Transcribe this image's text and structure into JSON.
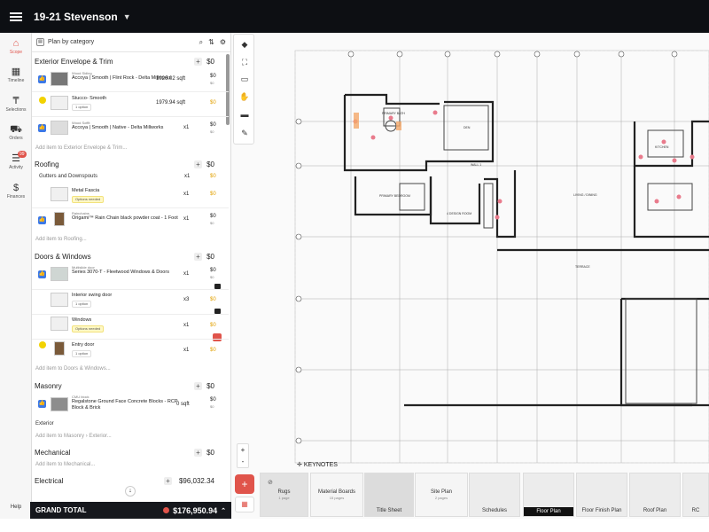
{
  "topbar": {
    "project_name": "19-21 Stevenson"
  },
  "nav": {
    "items": [
      {
        "label": "Scope",
        "icon": "home-icon"
      },
      {
        "label": "Timeline",
        "icon": "calendar-icon"
      },
      {
        "label": "Selections",
        "icon": "paint-roller-icon"
      },
      {
        "label": "Orders",
        "icon": "cart-icon"
      },
      {
        "label": "Activity",
        "icon": "activity-icon",
        "badge": "99"
      },
      {
        "label": "Finances",
        "icon": "dollar-icon"
      }
    ],
    "help": "Help"
  },
  "panel": {
    "header": "Plan by category",
    "sections": {
      "exterior": {
        "title": "Exterior Envelope & Trim",
        "total": "$0",
        "items": [
          {
            "category": "Wood Siding",
            "name": "Accoya | Smooth | Flint Rock - Delta Millworks",
            "qty": "1026.02 sqft",
            "price": "$0",
            "sub": "$0"
          },
          {
            "name": "Stucco- Smooth",
            "tag": "1 option",
            "qty": "1979.94 sqft",
            "price": "$0"
          },
          {
            "category": "Wood Soffit",
            "name": "Accoya | Smooth | Native - Delta Millworks",
            "qty": "x1",
            "price": "$0",
            "sub": "$0"
          }
        ],
        "add": "Add item to Exterior Envelope & Trim..."
      },
      "roofing": {
        "title": "Roofing",
        "total": "$0",
        "group": "Gutters and Downspouts",
        "group_qty": "x1",
        "group_price": "$0",
        "items": [
          {
            "name": "Metal Fascia",
            "tag": "Options needed",
            "qty": "x1",
            "price": "$0"
          },
          {
            "category": "Rainchains",
            "name": "Origami™ Rain Chain black powder coat - 1 Foot",
            "qty": "x1",
            "price": "$0",
            "sub": "$0"
          }
        ],
        "add": "Add item to Roofing..."
      },
      "doors": {
        "title": "Doors & Windows",
        "total": "$0",
        "items": [
          {
            "category": "Multislide door",
            "name": "Series 3070-T - Fleetwood Windows & Doors",
            "qty": "x1",
            "price": "$0",
            "sub": "$0"
          },
          {
            "name": "Interior swing door",
            "tag": "1 option",
            "qty": "x3",
            "price": "$0"
          },
          {
            "name": "Windows",
            "tag": "Options needed",
            "qty": "x1",
            "price": "$0"
          },
          {
            "name": "Entry door",
            "tag": "1 option",
            "qty": "x1",
            "price": "$0"
          }
        ],
        "add": "Add item to Doors & Windows..."
      },
      "masonry": {
        "title": "Masonry",
        "total": "$0",
        "items": [
          {
            "category": "CMU block",
            "name": "Regalstone Ground Face Concrete Blocks - RCP Block & Brick",
            "qty": "0 sqft",
            "price": "$0",
            "sub": "$0"
          }
        ],
        "add": "Add item to Masonry › Exterior...",
        "sub_group": "Exterior"
      },
      "mechanical": {
        "title": "Mechanical",
        "total": "$0",
        "add": "Add item to Mechanical..."
      },
      "electrical": {
        "title": "Electrical",
        "total": "$96,032.34"
      }
    },
    "grand_total_label": "GRAND TOTAL",
    "grand_total_value": "$176,950.94"
  },
  "canvas": {
    "keynotes": "KEYNOTES",
    "zoom_in": "+",
    "zoom_out": "-",
    "sheets": [
      {
        "label": "Rugs",
        "sub": "1 page",
        "type": "card"
      },
      {
        "label": "Material Boards",
        "sub": "15 pages",
        "type": "card"
      },
      {
        "label": "Title Sheet",
        "type": "thumb"
      },
      {
        "label": "Site Plan",
        "sub": "2 pages",
        "type": "card"
      },
      {
        "label": "Schedules",
        "type": "thumb"
      },
      {
        "label": "Floor Plan",
        "type": "thumb",
        "selected": true
      },
      {
        "label": "Floor Finish Plan",
        "type": "thumb"
      },
      {
        "label": "Roof Plan",
        "type": "thumb"
      },
      {
        "label": "RC",
        "type": "thumb"
      }
    ],
    "plan_labels": {
      "primary_bath": "PRIMARY BATH",
      "den": "DEN",
      "wall": "WALL 1",
      "primary_bedroom": "PRIMARY BEDROOM",
      "living": "LIVING / DINING",
      "kitchen": "KITCHEN",
      "terrace": "TERRACE",
      "reading": "4 DESIGN ROOM"
    }
  },
  "colors": {
    "accent": "#e0544b",
    "link": "#3b78e7",
    "warn": "#f2d200"
  }
}
